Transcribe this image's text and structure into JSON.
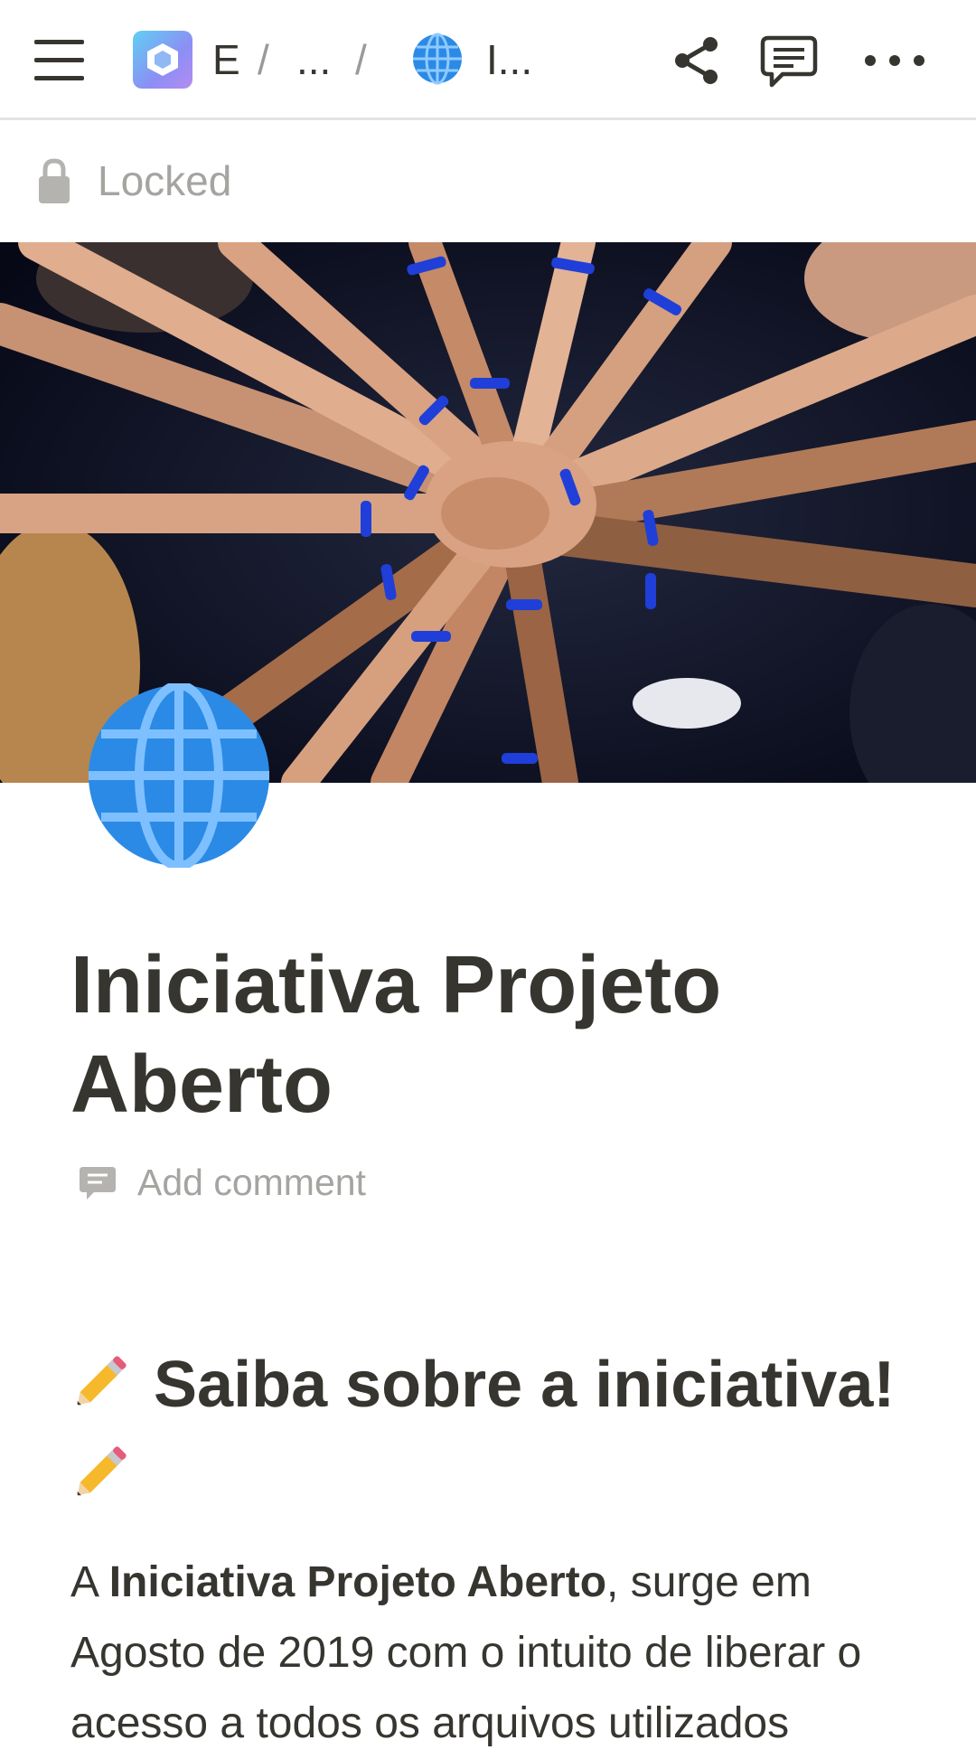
{
  "topbar": {
    "breadcrumb": {
      "workspace_label": "E",
      "separator": "/",
      "ellipsis": "...",
      "page_label": "I..."
    }
  },
  "lock": {
    "label": "Locked"
  },
  "page": {
    "title": "Iniciativa Projeto Aberto",
    "add_comment_label": "Add comment"
  },
  "content": {
    "heading": "Saiba sobre a iniciativa!",
    "paragraph": {
      "prefix": "A ",
      "bold": "Iniciativa Projeto Aberto",
      "rest": ", surge em Agosto de 2019 com o intuito de liberar o acesso a todos os arquivos utilizados"
    }
  },
  "colors": {
    "text": "#37352f",
    "muted": "#a5a4a1",
    "divider": "#e3e3e1",
    "wristband": "#1f3fd8"
  },
  "icons": [
    "menu-icon",
    "workspace-icon",
    "globe-icon",
    "share-icon",
    "comments-icon",
    "more-icon",
    "lock-icon",
    "comment-icon",
    "pencil-icon"
  ]
}
